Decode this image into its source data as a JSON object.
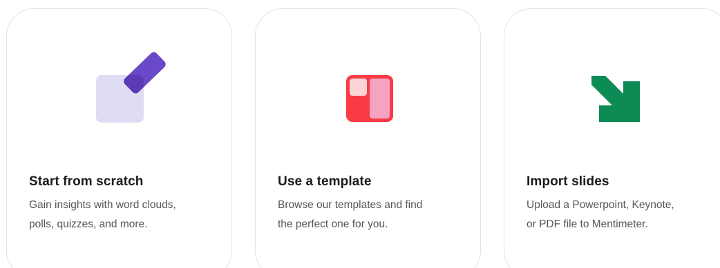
{
  "cards": [
    {
      "icon": "edit-pencil-icon",
      "title": "Start from scratch",
      "description": [
        "Gain insights with word clouds,",
        "polls, quizzes, and more."
      ]
    },
    {
      "icon": "template-layout-icon",
      "title": "Use a template",
      "description": [
        "Browse our templates and find",
        "the perfect one for you."
      ]
    },
    {
      "icon": "import-arrow-icon",
      "title": "Import slides",
      "description": [
        "Upload a Powerpoint, Keynote,",
        "or PDF file to Mentimeter."
      ]
    }
  ],
  "colors": {
    "scratch_square": "#e0dcf3",
    "scratch_pencil": "#6a49c8",
    "template_red": "#f83b44",
    "template_pink": "#f6a3c2",
    "template_light": "#fbd5d6",
    "import_green": "#0d8b55"
  }
}
